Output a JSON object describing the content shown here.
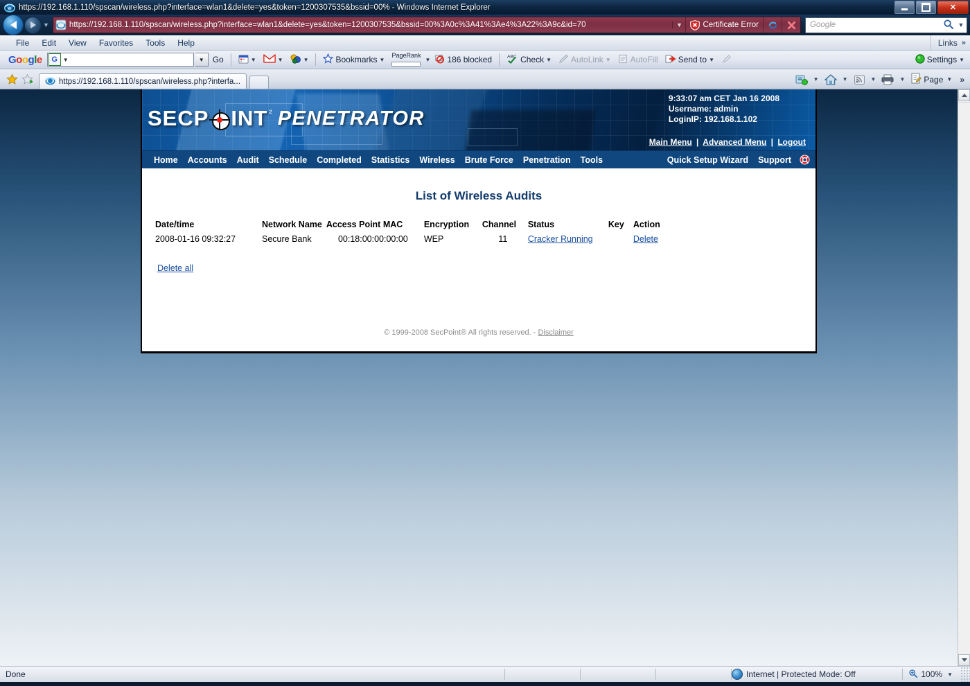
{
  "browser": {
    "window_title": "https://192.168.1.110/spscan/wireless.php?interface=wlan1&delete=yes&token=1200307535&bssid=00% - Windows Internet Explorer",
    "address_value": "https://192.168.1.110/spscan/wireless.php?interface=wlan1&delete=yes&token=1200307535&bssid=00%3A0c%3A41%3Ae4%3A22%3A9c&id=70",
    "certificate_error": "Certificate Error",
    "search_placeholder": "Google",
    "menu": [
      {
        "label": "File",
        "accel": "F"
      },
      {
        "label": "Edit",
        "accel": "E"
      },
      {
        "label": "View",
        "accel": "V"
      },
      {
        "label": "Favorites",
        "accel": "a"
      },
      {
        "label": "Tools",
        "accel": "T"
      },
      {
        "label": "Help",
        "accel": "H"
      }
    ],
    "links_label": "Links",
    "links_chevron": "»",
    "google_toolbar": {
      "logo": "Google",
      "search_value": "",
      "search_badge": "G",
      "go_label": "Go",
      "bookmarks_label": "Bookmarks",
      "pagerank_label": "PageRank",
      "blocked_label": "186 blocked",
      "check_label": "Check",
      "autolink_label": "AutoLink",
      "autofill_label": "AutoFill",
      "sendto_label": "Send to",
      "settings_label": "Settings"
    },
    "tab": {
      "title": "https://192.168.1.110/spscan/wireless.php?interfa..."
    },
    "command_bar": {
      "page_label": "Page",
      "more_chevron": "»"
    },
    "status": {
      "message": "Done",
      "zone": "Internet | Protected Mode: Off",
      "zoom": "100%"
    }
  },
  "page": {
    "logo": {
      "brand": "SECP",
      "brand_tail": "INT",
      "registered": "²",
      "product": "PENETRATOR"
    },
    "session": {
      "time": "9:33:07 am CET Jan 16 2008",
      "username": "Username: admin",
      "login_ip": "LoginIP: 192.168.1.102",
      "links": [
        {
          "label": "Main Menu"
        },
        {
          "label": "Advanced Menu"
        },
        {
          "label": "Logout"
        }
      ],
      "separator": "|"
    },
    "nav": [
      {
        "label": "Home"
      },
      {
        "label": "Accounts"
      },
      {
        "label": "Audit"
      },
      {
        "label": "Schedule"
      },
      {
        "label": "Completed"
      },
      {
        "label": "Statistics"
      },
      {
        "label": "Wireless"
      },
      {
        "label": "Brute Force"
      },
      {
        "label": "Penetration"
      },
      {
        "label": "Tools"
      }
    ],
    "nav_right": [
      {
        "label": "Quick Setup Wizard"
      },
      {
        "label": "Support"
      }
    ],
    "title": "List of Wireless Audits",
    "table": {
      "headers": [
        "Date/time",
        "Network Name",
        "Access Point MAC",
        "Encryption",
        "Channel",
        "Status",
        "Key",
        "Action"
      ],
      "rows": [
        {
          "datetime": "2008-01-16 09:32:27",
          "network_name": "Secure Bank",
          "mac": "00:18:00:00:00:00",
          "encryption": "WEP",
          "channel": "11",
          "status": "Cracker Running",
          "key": "",
          "action": "Delete"
        }
      ]
    },
    "delete_all_label": "Delete all",
    "footer": {
      "copyright": "© 1999-2008 SecPoint® All rights reserved. -",
      "disclaimer": "Disclaimer"
    }
  }
}
